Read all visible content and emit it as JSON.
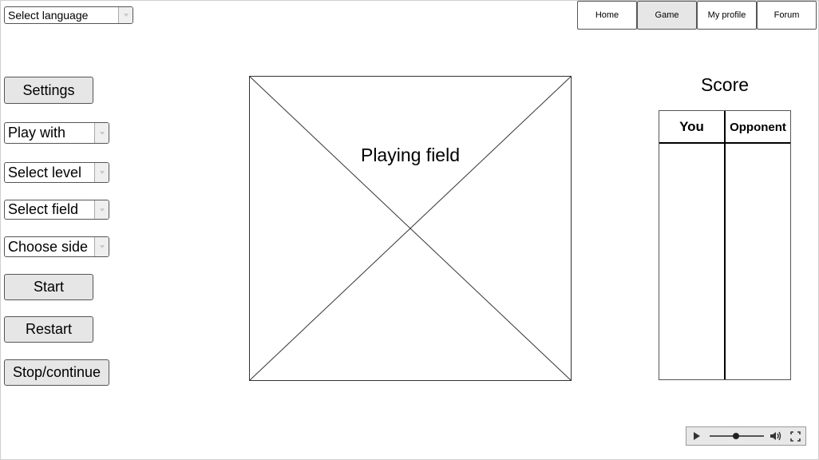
{
  "language_select": {
    "label": "Select language"
  },
  "nav": {
    "tabs": [
      {
        "label": "Home",
        "active": false
      },
      {
        "label": "Game",
        "active": true
      },
      {
        "label": "My profile",
        "active": false
      },
      {
        "label": "Forum",
        "active": false
      }
    ]
  },
  "controls": {
    "settings_label": "Settings",
    "play_with": "Play with",
    "select_level": "Select level",
    "select_field": "Select field",
    "choose_side": "Choose side",
    "start_label": "Start",
    "restart_label": "Restart",
    "stop_continue_label": "Stop/continue"
  },
  "playing_field": {
    "label": "Playing field"
  },
  "score": {
    "title": "Score",
    "columns": [
      "You",
      "Opponent"
    ]
  },
  "media_player": {
    "progress": 0.48
  }
}
